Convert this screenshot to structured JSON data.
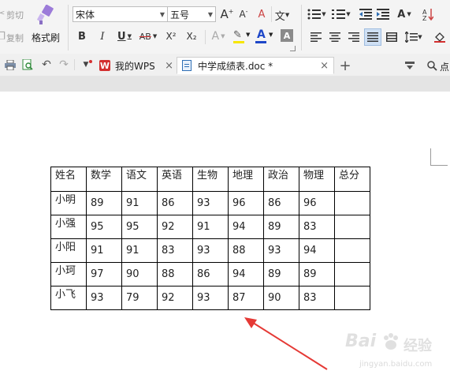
{
  "ribbon": {
    "cut_label": "剪切",
    "copy_label": "复制",
    "format_painter_label": "格式刷",
    "font_name": "宋体",
    "font_size": "五号",
    "grow_font": "A",
    "shrink_font": "A",
    "bold": "B",
    "italic": "I",
    "underline": "U",
    "strikethrough": "AB",
    "superscript": "X²",
    "subscript": "X₂",
    "text_effect": "A",
    "highlight_color": "#f7e600",
    "font_color_letter": "A",
    "font_color": "#1e47c8",
    "char_shading": "A",
    "phonetic": "文",
    "clear_format": "A",
    "style_letter": "A"
  },
  "tabs": {
    "home_label": "我的WPS",
    "doc_label": "中学成绩表.doc *",
    "add_label": "+",
    "close_glyph": "×",
    "right_label": "点"
  },
  "colors": {
    "wps_red": "#d32f2f",
    "arrow_red": "#e53935",
    "doc_blue": "#2f6fb5"
  },
  "table": {
    "header": [
      "姓名",
      "数学",
      "语文",
      "英语",
      "生物",
      "地理",
      "政治",
      "物理",
      "总分"
    ],
    "rows": [
      [
        "小明",
        "89",
        "91",
        "86",
        "93",
        "96",
        "86",
        "96",
        ""
      ],
      [
        "小强",
        "95",
        "95",
        "92",
        "91",
        "94",
        "89",
        "83",
        ""
      ],
      [
        "小阳",
        "91",
        "91",
        "83",
        "93",
        "88",
        "93",
        "94",
        ""
      ],
      [
        "小珂",
        "97",
        "90",
        "88",
        "86",
        "94",
        "89",
        "89",
        ""
      ],
      [
        "小飞",
        "93",
        "79",
        "92",
        "93",
        "87",
        "90",
        "83",
        ""
      ]
    ]
  },
  "watermark": {
    "brand": "Bai",
    "brand_tail": "经验",
    "url": "jingyan.baidu.com"
  }
}
